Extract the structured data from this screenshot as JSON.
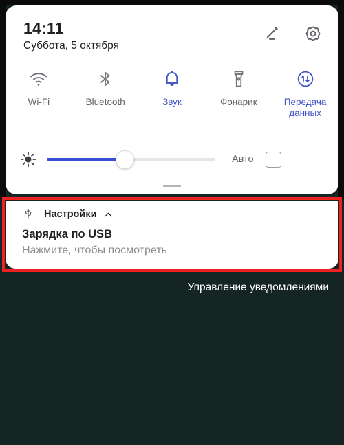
{
  "status": {
    "time": "14:11",
    "date": "Суббота, 5 октября"
  },
  "header": {
    "edit_icon": "pencil-icon",
    "settings_icon": "gear-icon"
  },
  "quick_settings": {
    "toggles": [
      {
        "label": "Wi-Fi",
        "icon": "wifi-icon",
        "active": false
      },
      {
        "label": "Bluetooth",
        "icon": "bluetooth-icon",
        "active": false
      },
      {
        "label": "Звук",
        "icon": "bell-icon",
        "active": true
      },
      {
        "label": "Фонарик",
        "icon": "flashlight-icon",
        "active": false
      },
      {
        "label": "Передача\nданных",
        "icon": "mobile-data-icon",
        "active": true
      }
    ],
    "brightness": {
      "icon": "brightness-icon",
      "value_percent": 47,
      "auto_label": "Авто",
      "auto_checked": false
    }
  },
  "notification": {
    "app_icon": "usb-icon",
    "app_name": "Настройки",
    "expand_icon": "chevron-up-icon",
    "title": "Зарядка по USB",
    "subtitle": "Нажмите, чтобы посмотреть",
    "highlight_color": "#ee2222"
  },
  "footer": {
    "manage_label": "Управление уведомлениями"
  },
  "colors": {
    "accent": "#4255c7",
    "slider_fill": "#3a4ed8",
    "icon_gray": "#5f6368",
    "wallpaper": "#142523"
  }
}
